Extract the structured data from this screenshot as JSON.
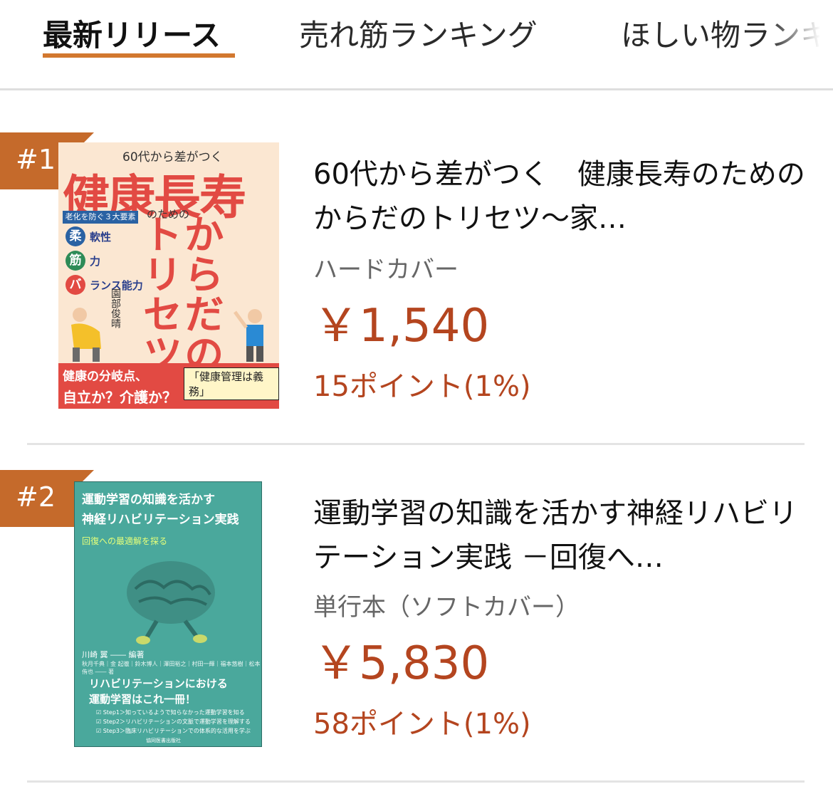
{
  "tabs": [
    {
      "label": "最新リリース",
      "active": true
    },
    {
      "label": "売れ筋ランキング",
      "active": false
    },
    {
      "label": "ほしい物ランキング",
      "active": false
    }
  ],
  "accent_color": "#d2782f",
  "badge_color": "#c56a2b",
  "price_color": "#b4451f",
  "items": [
    {
      "rank": "#1",
      "title": "60代から差がつく　健康長寿のための　からだのトリセツ〜家…",
      "format": "ハードカバー",
      "price": "￥1,540",
      "points": "15ポイント(1%)",
      "cover": {
        "subtitle": "60代から差がつく",
        "big_title": "健康長寿",
        "note": "のための",
        "tag": "老化を防ぐ３大要素",
        "chips": [
          {
            "char": "柔",
            "text": "軟性",
            "color": "#2a62a3"
          },
          {
            "char": "筋",
            "text": "力",
            "color": "#2e8b57"
          },
          {
            "char": "バ",
            "text": "ランス能力",
            "color": "#e24a43"
          }
        ],
        "vertical_title": "からだのトリセツ",
        "author": "園部俊晴",
        "bottom_line1": "健康の分岐点、",
        "bottom_line2": "自立か？介護か？",
        "bottom_badge": "「健康管理は義務」"
      }
    },
    {
      "rank": "#2",
      "title": "運動学習の知識を活かす神経リハビリテーション実践 －回復へ…",
      "format": "単行本（ソフトカバー）",
      "price": "￥5,830",
      "points": "58ポイント(1%)",
      "cover": {
        "title_line1": "運動学習の知識を活かす",
        "title_line2": "神経リハビリテーション実践",
        "subtitle": "回復への最適解を探る",
        "author": "川崎 翼 ―― 編著",
        "coauthors": "秋月千典｜金 起徹｜鈴木博人｜澤田裕之｜村田一輝｜福本悠樹｜松本侑也 ―― 著",
        "promo_line1": "リハビリテーションにおける",
        "promo_line2": "運動学習はこれ一冊！",
        "steps": [
          "☑ Step1＞知っているようで知らなかった運動学習を知る",
          "☑ Step2＞リハビリテーションの文脈で運動学習を理解する",
          "☑ Step3＞臨床リハビリテーションでの体系的な活用を学ぶ"
        ],
        "publisher": "協同医書出版社"
      }
    }
  ]
}
